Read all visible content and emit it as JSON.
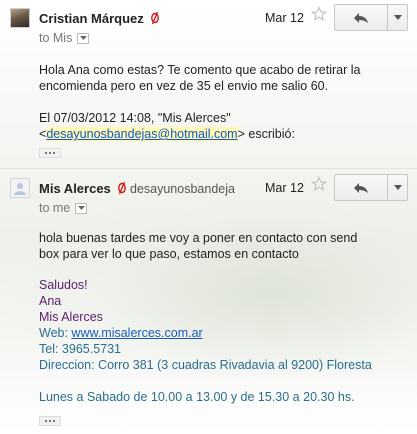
{
  "message1": {
    "sender": "Cristian Márquez",
    "date": "Mar 12",
    "to_label": "to Mis",
    "body_lines": [
      "Hola Ana como estas? Te comento que acabo de retirar la",
      "encomienda pero en vez de 35 el envio me salio 60."
    ],
    "quote_header_line1": "El 07/03/2012 14:08, \"Mis Alerces\"",
    "quote_email": "desayunosbandejas@hotmail.com",
    "quote_open": "<",
    "quote_suffix": "> escribió:"
  },
  "message2": {
    "sender": "Mis Alerces",
    "sender_email": "desayunosbandeja",
    "date": "Mar 12",
    "to_label": "to me",
    "body_lines": [
      "hola buenas tardes me voy a poner en contacto con send",
      "box para ver lo que paso, estamos en contacto"
    ],
    "signature": {
      "greeting": "Saludos!",
      "name": "Ana",
      "company": "Mis Alerces",
      "web_label": "Web: ",
      "web_link": "www.misalerces.com.ar",
      "tel": "Tel: 3965.5731",
      "address": "Direccion: Corro 381  (3 cuadras Rivadavia al 9200) Floresta",
      "hours": "Lunes a Sabado de 10.00 a 13.00 y de 15.30 a 20.30 hs."
    }
  },
  "icons": {
    "star": "star-icon",
    "reply": "reply-icon",
    "more": "dropdown-arrow-icon",
    "label_tag": "label-tag-icon"
  },
  "colors": {
    "signature_purple": "#5b1f6b",
    "signature_teal": "#2b6e8f",
    "link_blue": "#1a5bb5",
    "tag_red": "#cc1d1d"
  }
}
